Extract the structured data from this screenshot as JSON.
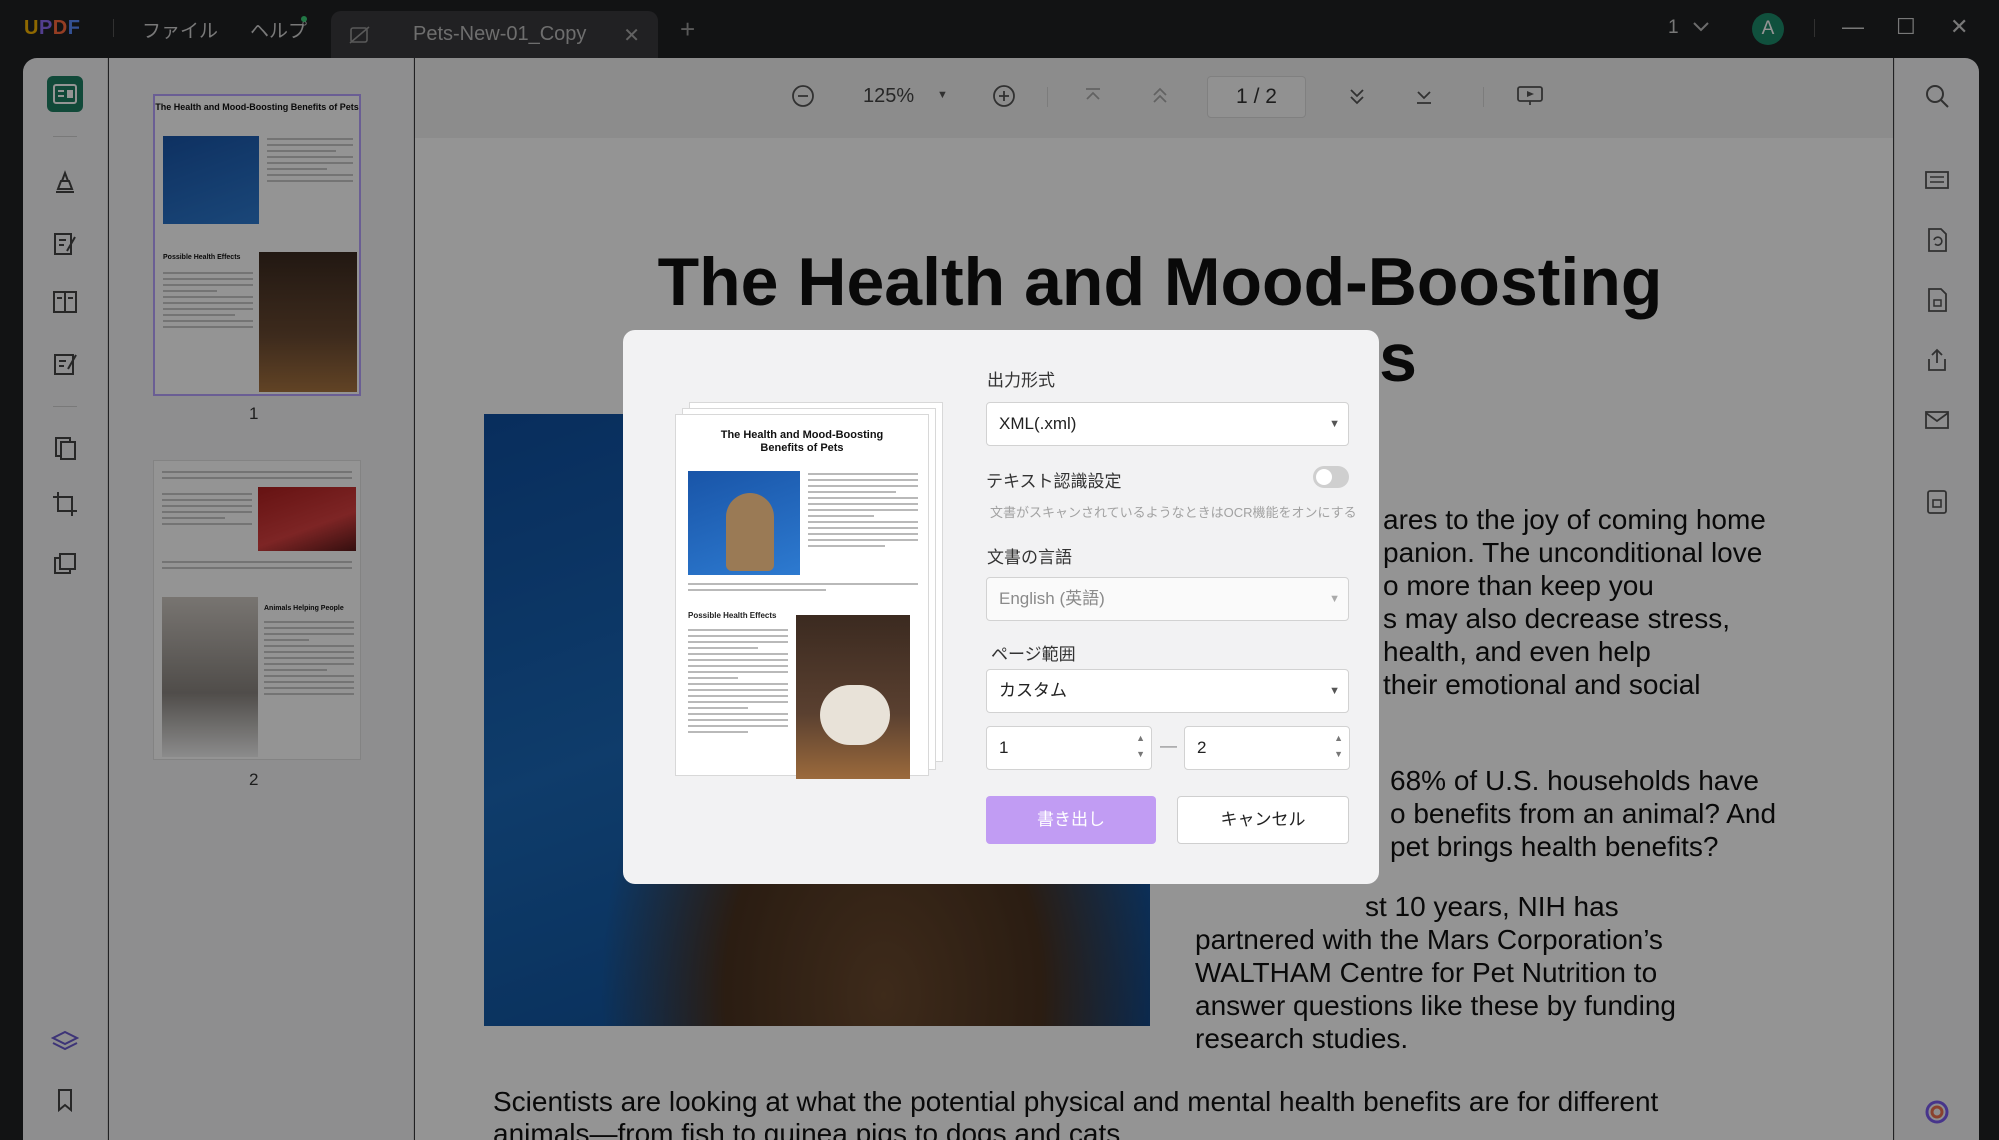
{
  "titlebar": {
    "logo_u": "U",
    "logo_p": "P",
    "logo_d": "D",
    "logo_f": "F",
    "menu_file": "ファイル",
    "menu_help": "ヘルプ",
    "tab_title": "Pets-New-01_Copy",
    "tab_close": "✕",
    "add_tab": "+",
    "account_count": "1",
    "avatar_letter": "A",
    "minimize": "—",
    "maximize": "☐",
    "close": "✕"
  },
  "toolbar": {
    "zoom_out": "⊖",
    "zoom_level": "125%",
    "zoom_caret": "▼",
    "zoom_in": "⊕",
    "first_page": "⤒",
    "prev_page": "︽",
    "current_page": "1",
    "page_sep": "/",
    "total_pages": "2",
    "next_page": "︾",
    "last_page": "⤓",
    "slideshow": "▭"
  },
  "thumbnails": {
    "items": [
      {
        "number": "1",
        "title": "The Health and Mood-Boosting Benefits of Pets",
        "section": "Possible Health Effects"
      },
      {
        "number": "2",
        "section": "Animals Helping People"
      }
    ]
  },
  "document": {
    "title_line1": "The Health and Mood-Boosting",
    "title_line2": "Benefits of Pets",
    "para1": [
      "ares to the joy of coming home",
      "panion. The unconditional love",
      "o more than keep you",
      "s may also decrease stress,",
      "health,  and  even  help",
      "their emotional and social"
    ],
    "para2": [
      "68% of U.S. households have",
      "o benefits from an animal? And",
      "pet brings health benefits?"
    ],
    "para3": [
      "st  10  years,  NIH  has",
      "partnered with the Mars Corporation’s",
      "WALTHAM Centre for  Pet  Nutrition  to",
      "answer  questions  like these by funding",
      "research studies."
    ],
    "bottom_line1": "Scientists are looking at what the potential physical and mental health benefits are for different",
    "bottom_line2": "animals—from fish to guinea pigs to dogs and cats."
  },
  "dialog": {
    "preview_title_line1": "The Health and Mood-Boosting",
    "preview_title_line2": "Benefits of Pets",
    "preview_section": "Possible Health Effects",
    "output_format_label": "出力形式",
    "output_format_value": "XML(.xml)",
    "ocr_label": "テキスト認識設定",
    "ocr_hint": "文書がスキャンされているようなときはOCR機能をオンにする",
    "ocr_enabled": false,
    "language_label": "文書の言語",
    "language_value": "English (英語)",
    "page_range_label": "ページ範囲",
    "page_range_value": "カスタム",
    "range_from": "1",
    "range_sep": "—",
    "range_to": "2",
    "spin_up": "▲",
    "spin_down": "▼",
    "caret": "▼",
    "export_button": "書き出し",
    "cancel_button": "キャンセル"
  },
  "colors": {
    "accent": "#c19cf3",
    "active_tool": "#1e7f63",
    "avatar": "#1c8a6a"
  }
}
